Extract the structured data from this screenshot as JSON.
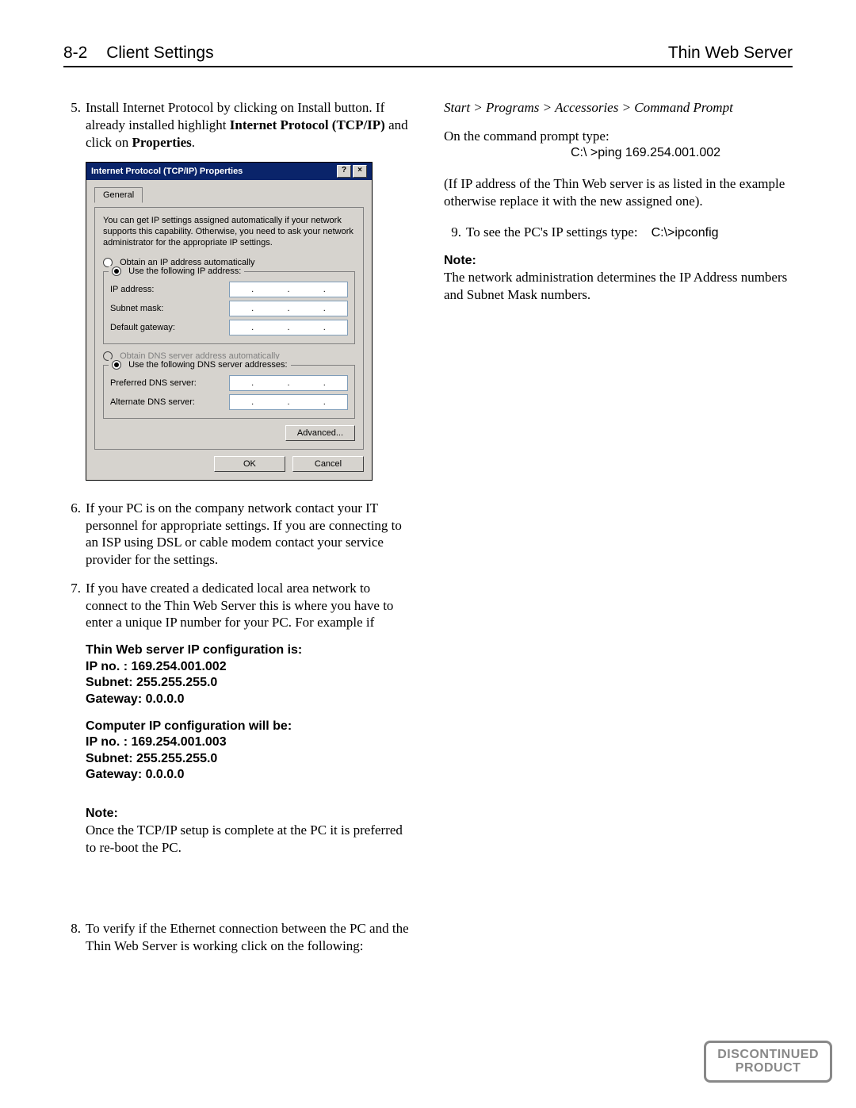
{
  "header": {
    "page_number": "8-2",
    "title": "Client Settings",
    "right": "Thin Web Server"
  },
  "left": {
    "step5": {
      "num": "5.",
      "line1": "Install Internet Protocol by clicking on Install button. If already installed highlight ",
      "bold1": "Internet Protocol (TCP/IP)",
      "line2": " and click on ",
      "bold2": "Properties",
      "tail": "."
    },
    "dialog": {
      "title": "Internet Protocol (TCP/IP) Properties",
      "help_btn": "?",
      "close_btn": "×",
      "tab_general": "General",
      "desc": "You can get IP settings assigned automatically if your network supports this capability. Otherwise, you need to ask your network administrator for the appropriate IP settings.",
      "radio_auto_ip": "Obtain an IP address automatically",
      "radio_use_ip": "Use the following IP address:",
      "lbl_ip": "IP address:",
      "lbl_subnet": "Subnet mask:",
      "lbl_gateway": "Default gateway:",
      "radio_auto_dns": "Obtain DNS server address automatically",
      "radio_use_dns": "Use the following DNS server addresses:",
      "lbl_pref_dns": "Preferred DNS server:",
      "lbl_alt_dns": "Alternate DNS server:",
      "btn_advanced": "Advanced...",
      "btn_ok": "OK",
      "btn_cancel": "Cancel"
    },
    "step6": {
      "num": "6.",
      "text": "If your PC is on the company network contact your IT personnel for appropriate settings. If you are connecting to an ISP using DSL or cable modem contact your service provider for the settings."
    },
    "step7": {
      "num": "7.",
      "text": "If you have created a dedicated local area network to connect to the Thin Web Server this is where you have to enter a unique IP number for your PC.  For example if"
    },
    "config_server": {
      "l1": "Thin Web server IP configuration is:",
      "l2": "IP no.  : 169.254.001.002",
      "l3": "Subnet: 255.255.255.0",
      "l4": "Gateway: 0.0.0.0"
    },
    "config_pc": {
      "l1": "Computer IP configuration will be:",
      "l2": "IP no.  : 169.254.001.003",
      "l3": "Subnet: 255.255.255.0",
      "l4": "Gateway: 0.0.0.0"
    },
    "note1": {
      "label": "Note:",
      "text": "Once the TCP/IP setup is complete at the PC it is preferred to re-boot the PC."
    },
    "step8": {
      "num": "8.",
      "text": "To verify if the Ethernet connection between the PC and the Thin Web Server is working click on the following:"
    }
  },
  "right": {
    "nav": "Start > Programs > Accessories > Command Prompt",
    "prompt_intro": "On the command prompt type:",
    "prompt_cmd": "C:\\ >ping 169.254.001.002",
    "if_text": "(If IP address of the Thin Web server is as listed in the example otherwise replace it with the new assigned one).",
    "step9": {
      "num": "9.",
      "text": "To see the PC's IP settings type:",
      "cmd": "C:\\>ipconfig"
    },
    "note2": {
      "label": "Note:",
      "text": "The network administration determines the IP Address numbers and Subnet Mask numbers."
    }
  },
  "stamp": {
    "l1": "DISCONTINUED",
    "l2": "PRODUCT"
  }
}
